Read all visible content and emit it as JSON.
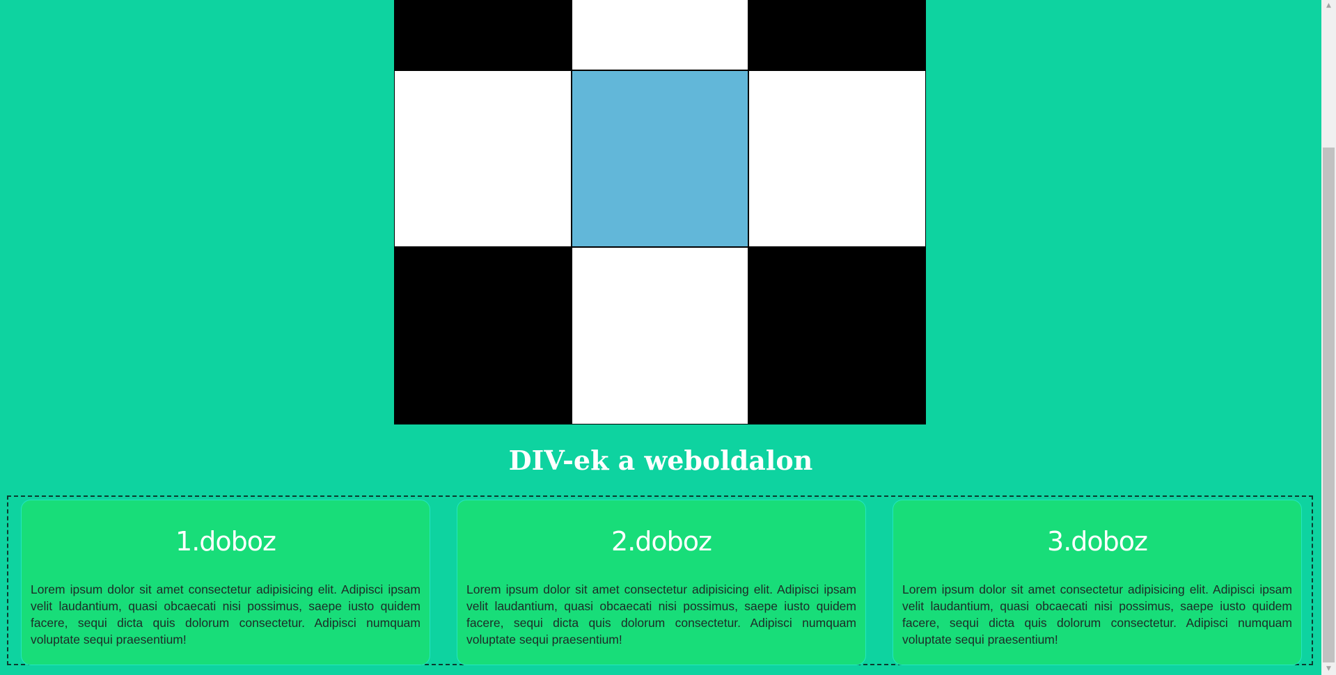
{
  "page": {
    "heading": "DIV-ek a weboldalon"
  },
  "grid": {
    "cells": [
      "black",
      "white",
      "black",
      "white",
      "blue",
      "white",
      "black",
      "white",
      "black"
    ]
  },
  "boxes": [
    {
      "title": "1.doboz",
      "text": "Lorem ipsum dolor sit amet consectetur adipisicing elit. Adipisci ipsam velit laudantium, quasi obcaecati nisi possimus, saepe iusto quidem facere, sequi dicta quis dolorum consectetur. Adipisci numquam voluptate sequi praesentium!"
    },
    {
      "title": "2.doboz",
      "text": "Lorem ipsum dolor sit amet consectetur adipisicing elit. Adipisci ipsam velit laudantium, quasi obcaecati nisi possimus, saepe iusto quidem facere, sequi dicta quis dolorum consectetur. Adipisci numquam voluptate sequi praesentium!"
    },
    {
      "title": "3.doboz",
      "text": "Lorem ipsum dolor sit amet consectetur adipisicing elit. Adipisci ipsam velit laudantium, quasi obcaecati nisi possimus, saepe iusto quidem facere, sequi dicta quis dolorum consectetur. Adipisci numquam voluptate sequi praesentium!"
    }
  ],
  "scrollbar": {
    "up_icon": "scroll-up-arrow-icon",
    "down_icon": "scroll-down-arrow-icon",
    "up_glyph": "▲",
    "down_glyph": "▼"
  },
  "colors": {
    "background": "#0ed3a0",
    "box_fill": "#18dd79",
    "highlight_cell": "#62b7d9"
  }
}
